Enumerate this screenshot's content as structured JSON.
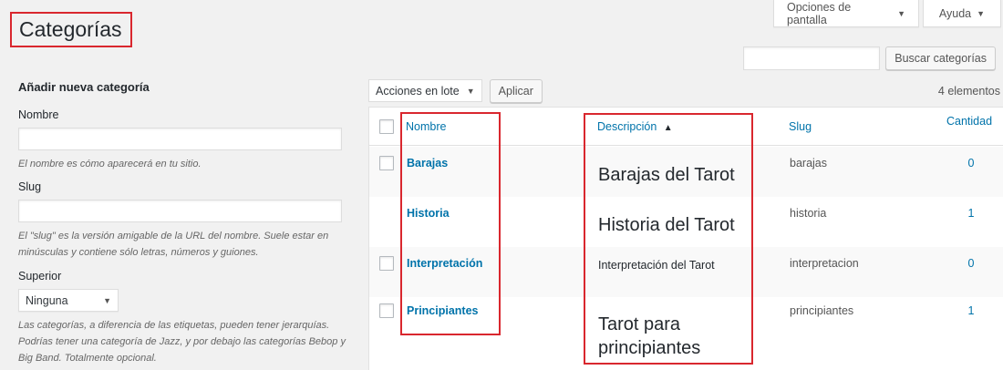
{
  "screen_options": {
    "label": "Opciones de pantalla",
    "caret": "▼"
  },
  "help": {
    "label": "Ayuda",
    "caret": "▼"
  },
  "page_title": "Categorías",
  "search": {
    "value": "",
    "button": "Buscar categorías"
  },
  "add_form": {
    "heading": "Añadir nueva categoría",
    "name_label": "Nombre",
    "name_value": "",
    "name_desc": "El nombre es cómo aparecerá en tu sitio.",
    "slug_label": "Slug",
    "slug_value": "",
    "slug_desc": "El \"slug\" es la versión amigable de la URL del nombre. Suele estar en minúsculas y contiene sólo letras, números y guiones.",
    "parent_label": "Superior",
    "parent_value": "Ninguna",
    "parent_desc": "Las categorías, a diferencia de las etiquetas, pueden tener jerarquías. Podrías tener una categoría de Jazz, y por debajo las categorías Bebop y Big Band. Totalmente opcional."
  },
  "tablenav": {
    "bulk_label": "Acciones en lote",
    "apply": "Aplicar",
    "count": "4 elementos"
  },
  "table": {
    "columns": {
      "name": "Nombre",
      "description": "Descripción",
      "sort_icon": "▲",
      "slug": "Slug",
      "count": "Cantidad"
    },
    "rows": [
      {
        "name": "Barajas",
        "description": "Barajas del Tarot",
        "slug": "barajas",
        "count": "0"
      },
      {
        "name": "Historia",
        "description": "Historia del Tarot",
        "slug": "historia",
        "count": "1"
      },
      {
        "name": "Interpretación",
        "description": "Interpretación del Tarot",
        "slug": "interpretacion",
        "count": "0"
      },
      {
        "name": "Principiantes",
        "description_line1": "Tarot para",
        "description_line2": "principiantes",
        "slug": "principiantes",
        "count": "1"
      }
    ]
  },
  "colors": {
    "link": "#0073aa",
    "highlight": "#d9272e",
    "background": "#f1f1f1"
  }
}
